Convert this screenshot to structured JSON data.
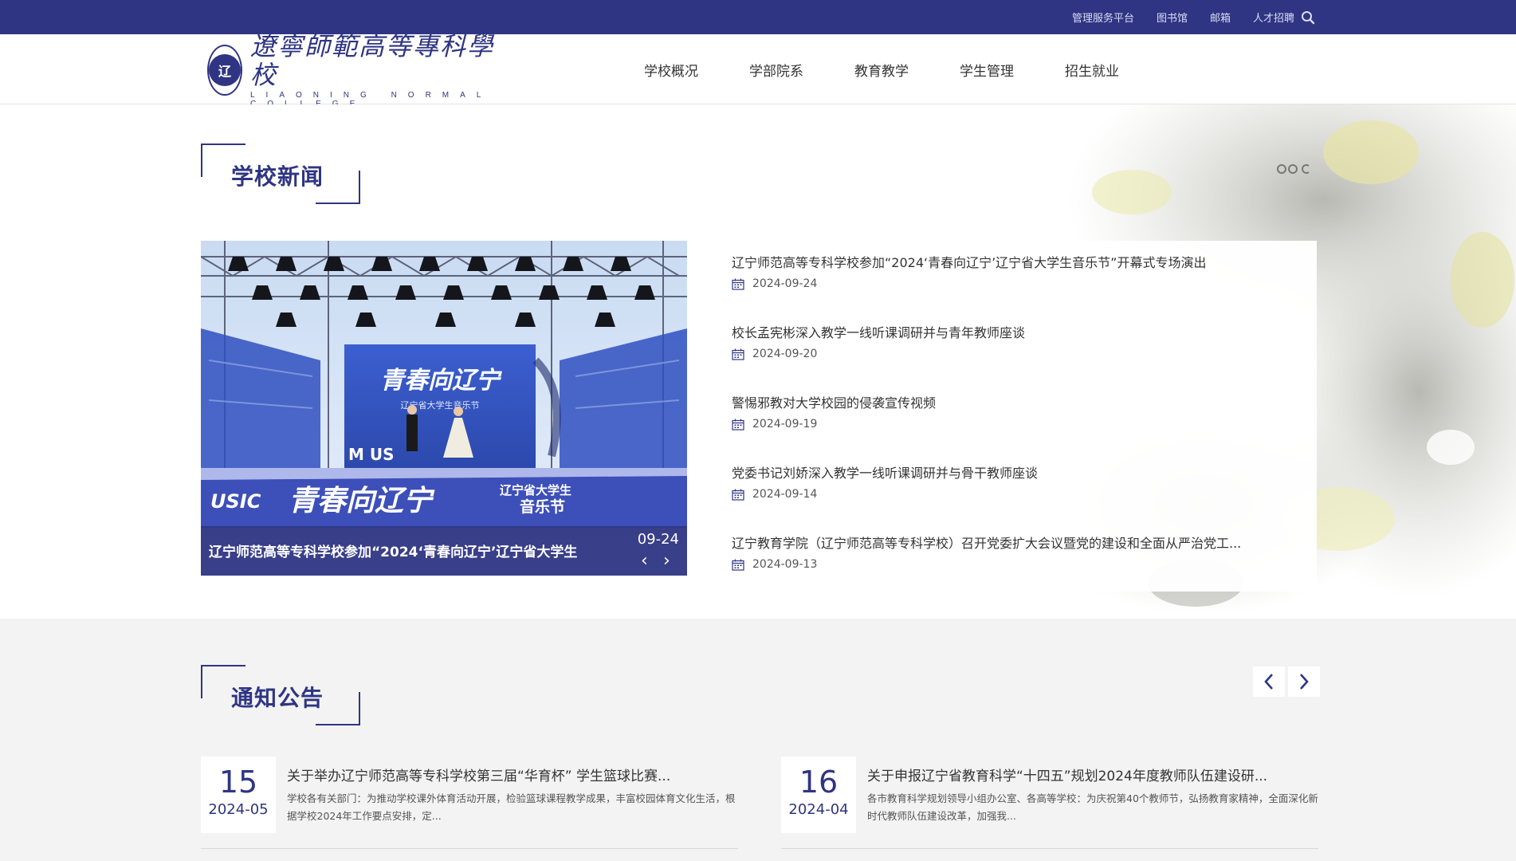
{
  "topbar": {
    "links": [
      "管理服务平台",
      "图书馆",
      "邮箱",
      "人才招聘"
    ],
    "search_icon": "search-icon"
  },
  "header": {
    "logo_seal_text": "辽",
    "logo_cn": "遼寧師範高等專科學校",
    "logo_en": "LIAONING NORMAL COLLEGE",
    "nav": [
      "学校概况",
      "学部院系",
      "教育教学",
      "学生管理",
      "招生就业"
    ]
  },
  "news": {
    "section_title": "学校新闻",
    "hero": {
      "caption": "辽宁师范高等专科学校参加“2024‘青春向辽宁’辽宁省大学生",
      "date": "09-24",
      "stage_title": "青春向辽宁",
      "stage_sub": "辽宁省大学生音乐节",
      "banner_left": "USIC",
      "banner_main": "青春向辽宁",
      "banner_right_1": "辽宁省大学生",
      "banner_right_2": "音乐节",
      "music_letters": "M   US"
    },
    "items": [
      {
        "title": "辽宁师范高等专科学校参加“2024‘青春向辽宁’辽宁省大学生音乐节”开幕式专场演出",
        "date": "2024-09-24"
      },
      {
        "title": "校长孟宪彬深入教学一线听课调研并与青年教师座谈",
        "date": "2024-09-20"
      },
      {
        "title": "警惕邪教对大学校园的侵袭宣传视频",
        "date": "2024-09-19"
      },
      {
        "title": "党委书记刘娇深入教学一线听课调研并与骨干教师座谈",
        "date": "2024-09-14"
      },
      {
        "title": "辽宁教育学院（辽宁师范高等专科学校）召开党委扩大会议暨党的建设和全面从严治党工...",
        "date": "2024-09-13"
      }
    ]
  },
  "notices": {
    "section_title": "通知公告",
    "items": [
      {
        "day": "15",
        "ym": "2024-05",
        "title": "关于举办辽宁师范高等专科学校第三届“华育杯” 学生篮球比赛...",
        "summary": "学校各有关部门：为推动学校课外体育活动开展，检验篮球课程教学成果，丰富校园体育文化生活，根据学校2024年工作要点安排，定..."
      },
      {
        "day": "16",
        "ym": "2024-04",
        "title": "关于申报辽宁省教育科学“十四五”规划2024年度教师队伍建设研...",
        "summary": "各市教育科学规划领导小组办公室、各高等学校：为庆祝第40个教师节，弘扬教育家精神，全面深化新时代教师队伍建设改革，加强我..."
      }
    ]
  },
  "colors": {
    "brand": "#2f3583",
    "notice_bg": "#f3f3f3"
  }
}
